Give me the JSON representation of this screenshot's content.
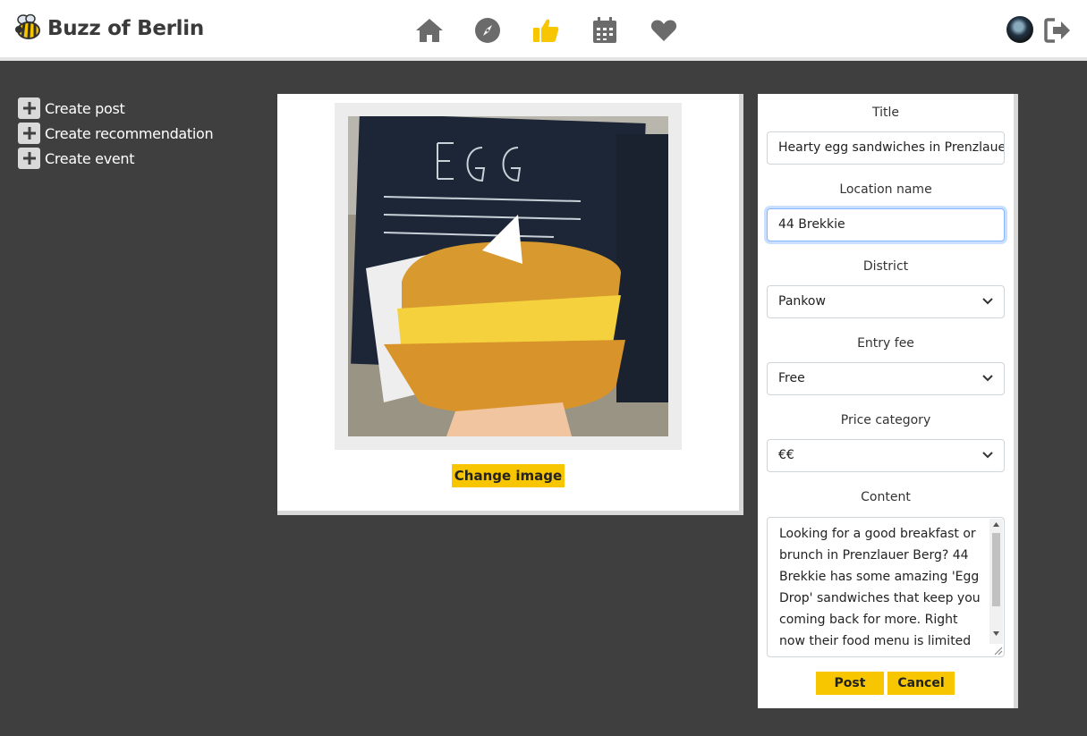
{
  "app": {
    "title": "Buzz of Berlin"
  },
  "nav": {
    "icons": [
      "home-icon",
      "compass-icon",
      "thumbs-up-icon",
      "calendar-icon",
      "heart-icon"
    ],
    "active": "thumbs-up-icon",
    "active_color": "#f7c600",
    "inactive_color": "#6b6b6b"
  },
  "sidebar": {
    "items": [
      {
        "label": "Create post",
        "icon": "plus-icon"
      },
      {
        "label": "Create recommendation",
        "icon": "plus-icon"
      },
      {
        "label": "Create event",
        "icon": "plus-icon"
      }
    ]
  },
  "image_panel": {
    "change_image_label": "Change image"
  },
  "form": {
    "title_label": "Title",
    "title_value": "Hearty egg sandwiches in Prenzlauer Berg",
    "location_label": "Location name",
    "location_value": "44 Brekkie",
    "district_label": "District",
    "district_value": "Pankow",
    "entry_fee_label": "Entry fee",
    "entry_fee_value": "Free",
    "price_label": "Price category",
    "price_value": "€€",
    "content_label": "Content",
    "content_value": "Looking for a good breakfast or brunch in Prenzlauer Berg? 44 Brekkie has some amazing 'Egg Drop' sandwiches that keep you coming back for more. Right now their food menu is limited",
    "post_label": "Post",
    "cancel_label": "Cancel"
  },
  "colors": {
    "accent": "#f7c600",
    "background": "#3f3f3f",
    "panel": "#ffffff"
  }
}
